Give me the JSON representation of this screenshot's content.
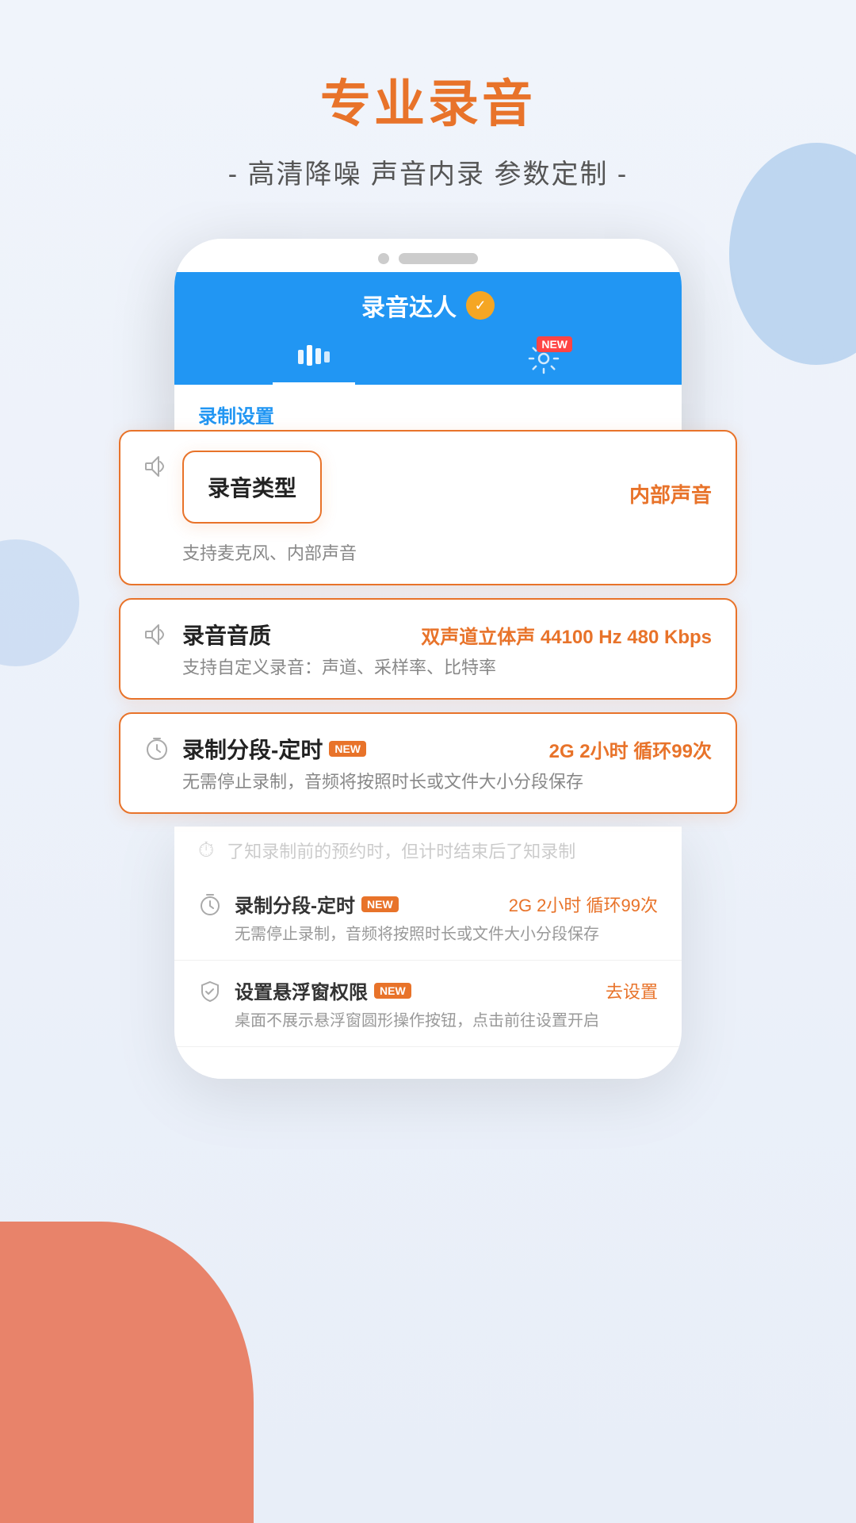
{
  "page": {
    "main_title": "专业录音",
    "sub_title": "- 高清降噪  声音内录  参数定制 -"
  },
  "app": {
    "name": "录音达人",
    "verified_symbol": "✓",
    "tab_waveform": "▌▌▌",
    "tab_gear": "⚙",
    "new_badge": "NEW",
    "section_title": "录制设置"
  },
  "phone_items": [
    {
      "icon": "🔈",
      "title": "录音类型",
      "value": "内部声音",
      "desc": ""
    }
  ],
  "highlights": [
    {
      "icon": "🔈",
      "title": "录音类型",
      "value": "内部声音",
      "desc": "支持麦克风、内部声音"
    },
    {
      "icon": "🔈",
      "title": "录音音质",
      "value": "双声道立体声 44100 Hz 480 Kbps",
      "desc": "支持自定义录音：声道、采样率、比特率"
    },
    {
      "icon": "⏱",
      "title": "录制分段-定时",
      "new_tag": "NEW",
      "value": "2G 2小时 循环99次",
      "desc": "无需停止录制，音频将按照时长或文件大小分段保存"
    }
  ],
  "faded_text": "了知录制前的预约时，但计时结束后了知录制",
  "bottom_items": [
    {
      "icon": "⏱",
      "title": "录制分段-定时",
      "new_tag": "NEW",
      "value": "2G 2小时 循环99次",
      "desc": "无需停止录制，音频将按照时长或文件大小分段保存"
    },
    {
      "icon": "🛡",
      "title": "设置悬浮窗权限",
      "new_tag": "NEW",
      "value": "去设置",
      "desc": "桌面不展示悬浮窗圆形操作按钮，点击前往设置开启"
    }
  ]
}
